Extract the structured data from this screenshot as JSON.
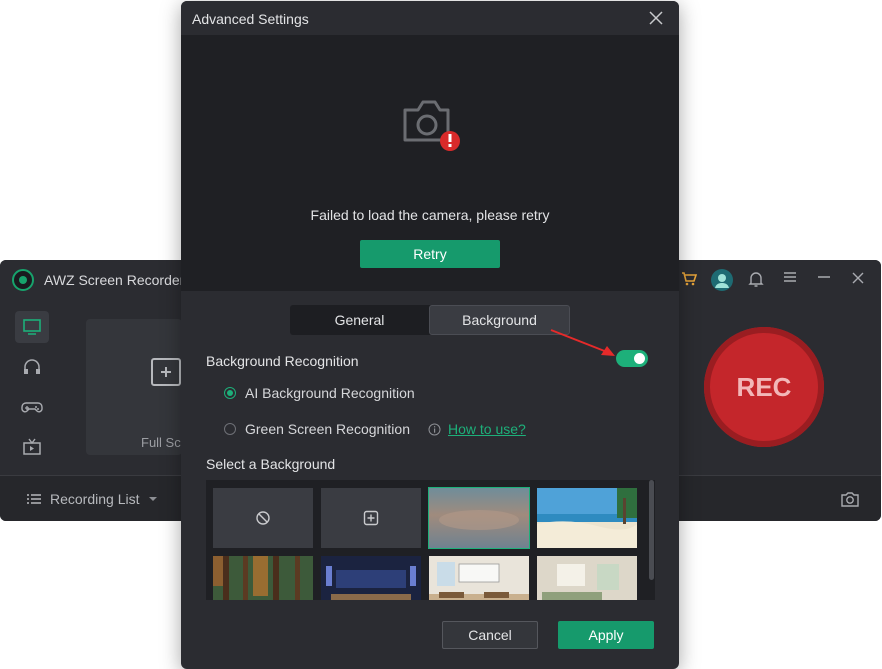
{
  "app": {
    "title": "AWZ Screen Recorder",
    "card_label": "Full Sc",
    "rec_label": "REC",
    "recording_list_label": "Recording List",
    "sidebar_icons": [
      "monitor-icon",
      "headphones-icon",
      "gamepad-icon",
      "tv-icon"
    ],
    "titlebar_icons": [
      "cart-icon",
      "avatar",
      "bell-icon",
      "menu-icon",
      "minimize-icon",
      "close-icon"
    ],
    "accent": "#17a36c",
    "rec_color": "#c4262b"
  },
  "dialog": {
    "title": "Advanced Settings",
    "camera_message": "Failed to load the camera, please retry",
    "retry_label": "Retry",
    "tabs": [
      {
        "label": "General",
        "active": false
      },
      {
        "label": "Background",
        "active": true
      }
    ],
    "background_recognition": {
      "label": "Background Recognition",
      "enabled": true
    },
    "options": [
      {
        "label": "AI Background Recognition",
        "selected": true
      },
      {
        "label": "Green Screen Recognition",
        "selected": false
      }
    ],
    "how_to_use": "How to use?",
    "select_background_label": "Select a Background",
    "backgrounds": [
      {
        "name": "none",
        "icon": "no-background-icon"
      },
      {
        "name": "add",
        "icon": "add-icon"
      },
      {
        "name": "blur",
        "selected": true
      },
      {
        "name": "beach"
      },
      {
        "name": "forest"
      },
      {
        "name": "studio"
      },
      {
        "name": "classroom"
      },
      {
        "name": "living-room"
      }
    ],
    "cancel_label": "Cancel",
    "apply_label": "Apply",
    "accent": "#169a6c",
    "error_color": "#d92a2a"
  }
}
